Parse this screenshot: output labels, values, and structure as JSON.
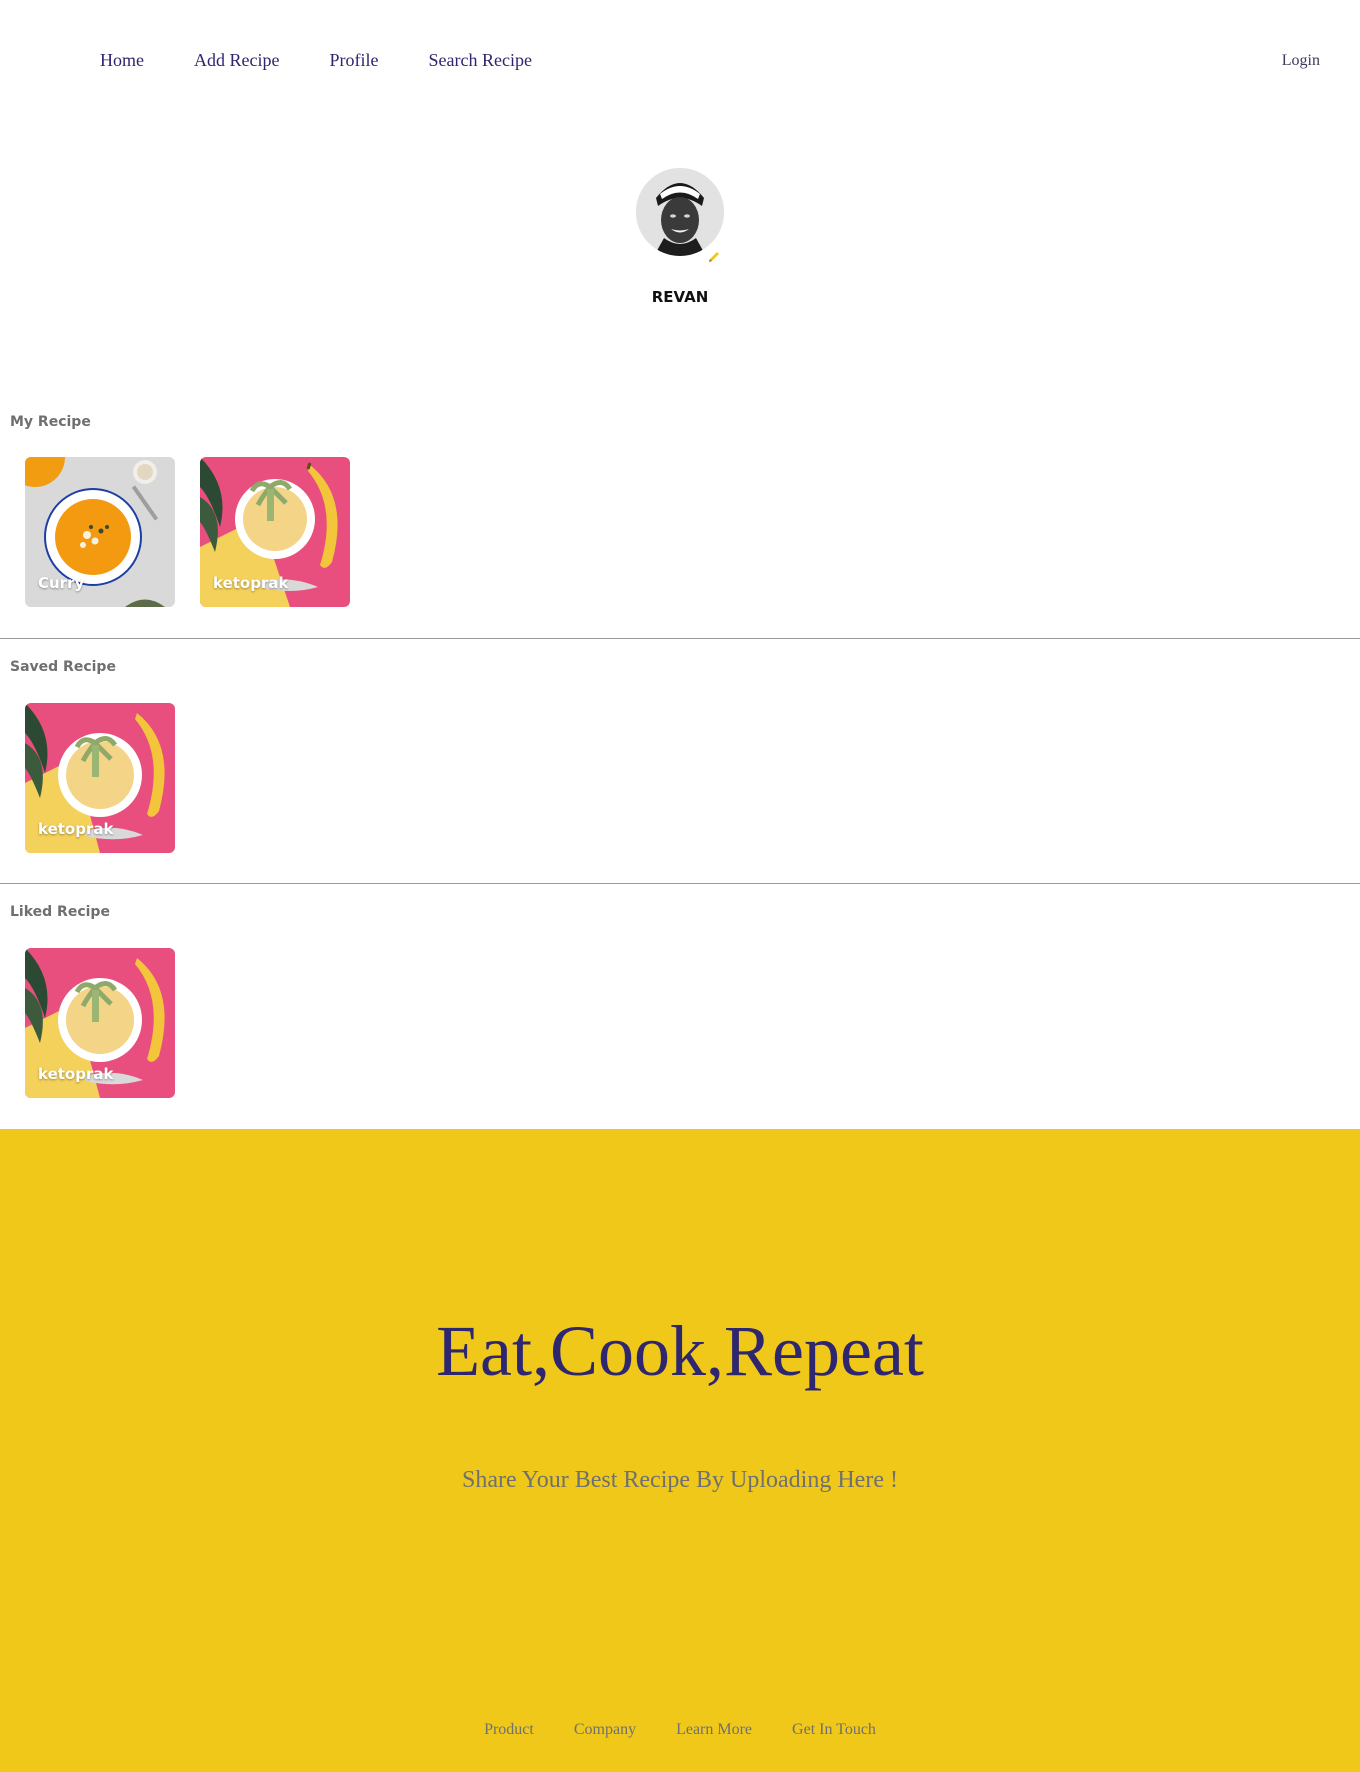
{
  "nav": {
    "items": [
      {
        "label": "Home"
      },
      {
        "label": "Add Recipe"
      },
      {
        "label": "Profile"
      },
      {
        "label": "Search Recipe"
      }
    ],
    "login_label": "Login"
  },
  "profile": {
    "username": "REVAN",
    "avatar_icon": "user-photo",
    "edit_icon": "pencil-icon"
  },
  "sections": {
    "my_recipe": {
      "title": "My Recipe",
      "cards": [
        {
          "label": "Curry"
        },
        {
          "label": "ketoprak"
        }
      ]
    },
    "saved_recipe": {
      "title": "Saved Recipe",
      "cards": [
        {
          "label": "ketoprak"
        }
      ]
    },
    "liked_recipe": {
      "title": "Liked Recipe",
      "cards": [
        {
          "label": "ketoprak"
        }
      ]
    }
  },
  "footer": {
    "headline": "Eat,Cook,Repeat",
    "tagline": "Share Your Best Recipe By Uploading Here !",
    "links": [
      {
        "label": "Product"
      },
      {
        "label": "Company"
      },
      {
        "label": "Learn More"
      },
      {
        "label": "Get In Touch"
      }
    ]
  },
  "colors": {
    "brand_yellow": "#EFC81A",
    "brand_navy": "#2E266F",
    "muted_text": "#707070"
  }
}
